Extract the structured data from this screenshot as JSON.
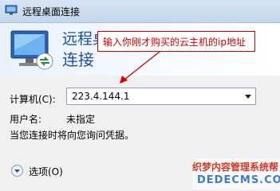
{
  "window": {
    "title": "远程桌面连接",
    "app_icon": "remote-desktop-icon"
  },
  "header": {
    "title_line1": "远程桌面",
    "title_line2": "连接",
    "illustration": "monitor-connection-icon"
  },
  "annotation": {
    "callout_text": "输入你刚才购买的云主机的ip地址",
    "color": "#d00000"
  },
  "form": {
    "computer_label": "计算机(C):",
    "computer_value": "223.4.144.1",
    "user_label": "用户名:",
    "user_value": "未指定",
    "credentials_note": "当您连接时将向您询问凭据。"
  },
  "options": {
    "label": "选项(O)",
    "icon": "expand-chevron-icon"
  },
  "watermark": {
    "line1": "织梦内容管理系统帮",
    "line2": "DEDECMS.COM"
  },
  "colors": {
    "title_blue": "#1f4fa3",
    "background": "#f0f0f0"
  }
}
